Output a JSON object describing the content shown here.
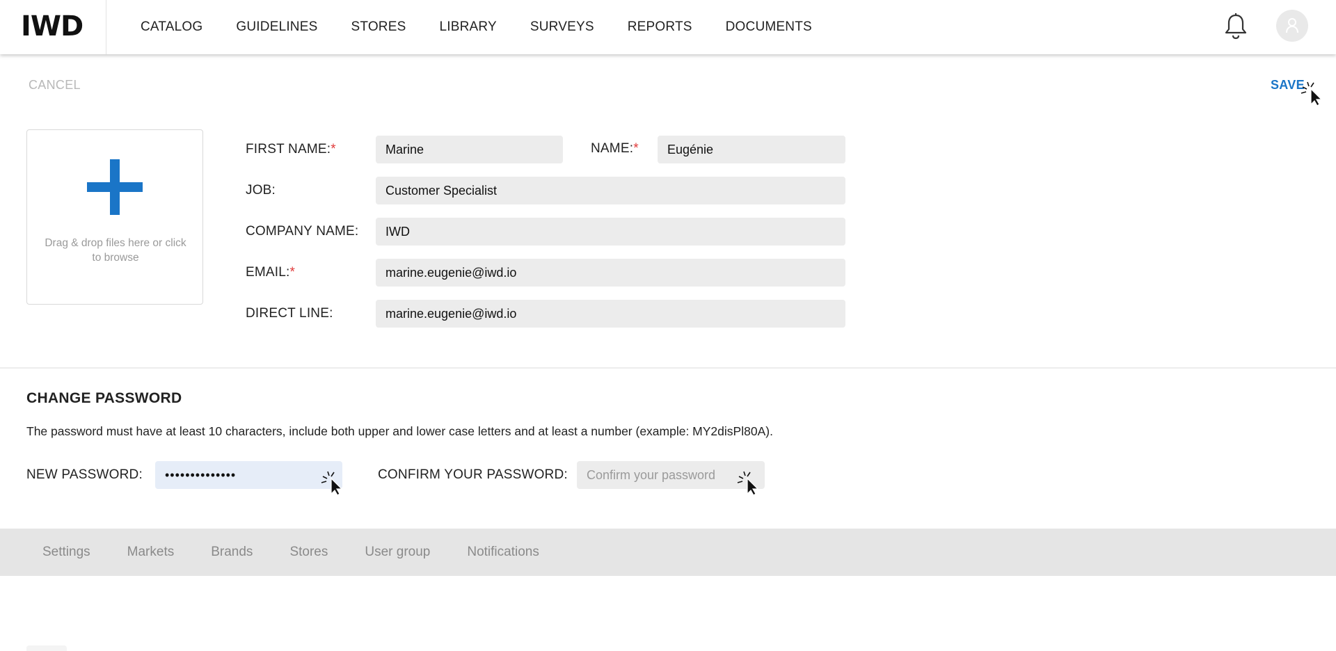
{
  "logo": "IWD",
  "nav": {
    "items": [
      "CATALOG",
      "GUIDELINES",
      "STORES",
      "LIBRARY",
      "SURVEYS",
      "REPORTS",
      "DOCUMENTS"
    ],
    "icons": {
      "notifications": "bell-icon",
      "profile": "user-avatar-icon"
    }
  },
  "actions": {
    "cancel_label": "CANCEL",
    "save_label": "SAVE"
  },
  "upload": {
    "text": "Drag & drop files here or click to browse",
    "icon": "plus-icon"
  },
  "form": {
    "first_name": {
      "label": "FIRST NAME:",
      "required_mark": "*",
      "value": "Marine"
    },
    "name": {
      "label": "NAME:",
      "required_mark": "*",
      "value": "Eugénie"
    },
    "job": {
      "label": "JOB:",
      "value": "Customer Specialist"
    },
    "company": {
      "label": "COMPANY NAME:",
      "value": "IWD"
    },
    "email": {
      "label": "EMAIL:",
      "required_mark": "*",
      "value": "marine.eugenie@iwd.io"
    },
    "direct_line": {
      "label": "DIRECT LINE:",
      "value": "marine.eugenie@iwd.io"
    }
  },
  "password": {
    "title": "CHANGE PASSWORD",
    "description": "The password must have at least 10 characters, include both upper and lower case letters and at least a number (example: MY2disPl80A).",
    "new_label": "NEW PASSWORD:",
    "new_value": "••••••••••••••",
    "confirm_label": "CONFIRM YOUR PASSWORD:",
    "confirm_placeholder": "Confirm your password"
  },
  "tabs": [
    "Settings",
    "Markets",
    "Brands",
    "Stores",
    "User group",
    "Notifications"
  ],
  "colors": {
    "accent": "#1a75c7",
    "required": "#e03a3a",
    "field_bg": "#ececec",
    "focused_field_bg": "#e6edf8",
    "tab_bar": "#e5e5e5"
  }
}
